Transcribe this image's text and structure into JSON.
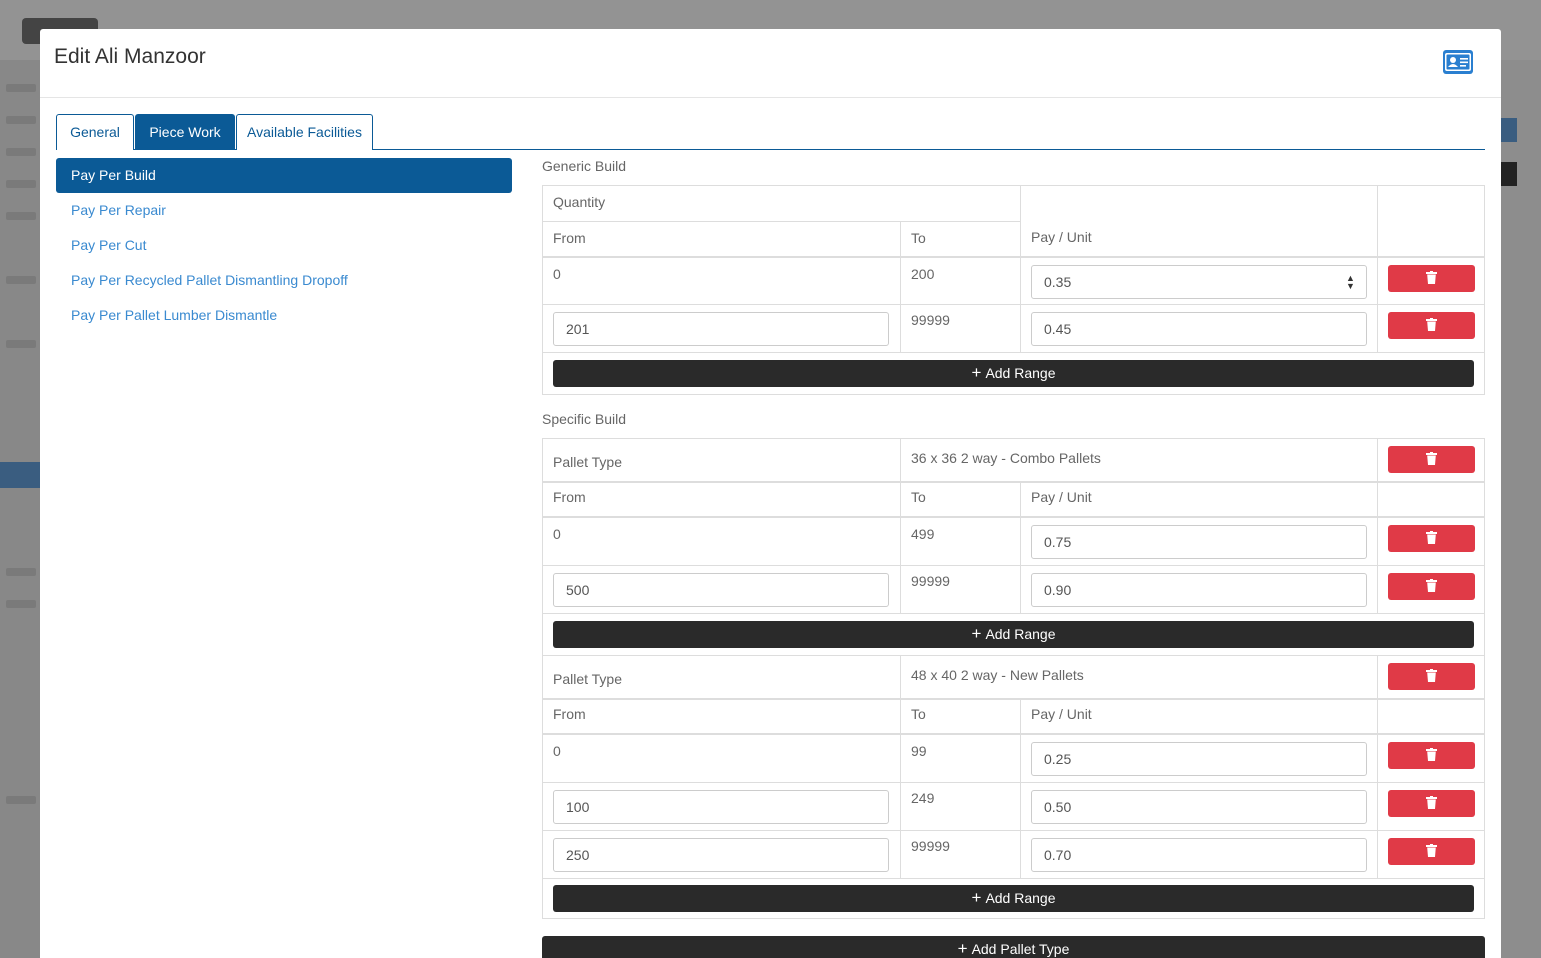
{
  "modal": {
    "title": "Edit Ali Manzoor",
    "header_icon": "contact-card-icon"
  },
  "tabs": [
    {
      "label": "General",
      "active": false
    },
    {
      "label": "Piece Work",
      "active": true
    },
    {
      "label": "Available Facilities",
      "active": false
    }
  ],
  "sidebar": {
    "items": [
      {
        "label": "Pay Per Build",
        "active": true
      },
      {
        "label": "Pay Per Repair"
      },
      {
        "label": "Pay Per Cut"
      },
      {
        "label": "Pay Per Recycled Pallet Dismantling Dropoff"
      },
      {
        "label": "Pay Per Pallet Lumber Dismantle"
      }
    ]
  },
  "generic": {
    "title": "Generic Build",
    "quantity_label": "Quantity",
    "from_label": "From",
    "to_label": "To",
    "pay_label": "Pay / Unit",
    "rows": [
      {
        "from": "0",
        "to": "200",
        "pay": "0.35"
      },
      {
        "from": "201",
        "to": "99999",
        "pay": "0.45"
      }
    ],
    "add_range": "Add Range"
  },
  "specific": {
    "title": "Specific Build",
    "groups": [
      {
        "pallet_type_label": "Pallet Type",
        "pallet_type": "36 x 36 2 way - Combo Pallets",
        "from_label": "From",
        "to_label": "To",
        "pay_label": "Pay / Unit",
        "rows": [
          {
            "from": "0",
            "to": "499",
            "pay": "0.75"
          },
          {
            "from": "500",
            "to": "99999",
            "pay": "0.90"
          }
        ],
        "add_range": "Add Range"
      },
      {
        "pallet_type_label": "Pallet Type",
        "pallet_type": "48 x 40 2 way - New Pallets",
        "from_label": "From",
        "to_label": "To",
        "pay_label": "Pay / Unit",
        "rows": [
          {
            "from": "0",
            "to": "99",
            "pay": "0.25"
          },
          {
            "from": "100",
            "to": "249",
            "pay": "0.50"
          },
          {
            "from": "250",
            "to": "99999",
            "pay": "0.70"
          }
        ],
        "add_range": "Add Range"
      }
    ],
    "add_pallet_type": "Add Pallet Type"
  },
  "colors": {
    "primary": "#0b5a96",
    "danger": "#e03a47",
    "dark": "#2a2a2a",
    "link": "#3a8ad0"
  }
}
